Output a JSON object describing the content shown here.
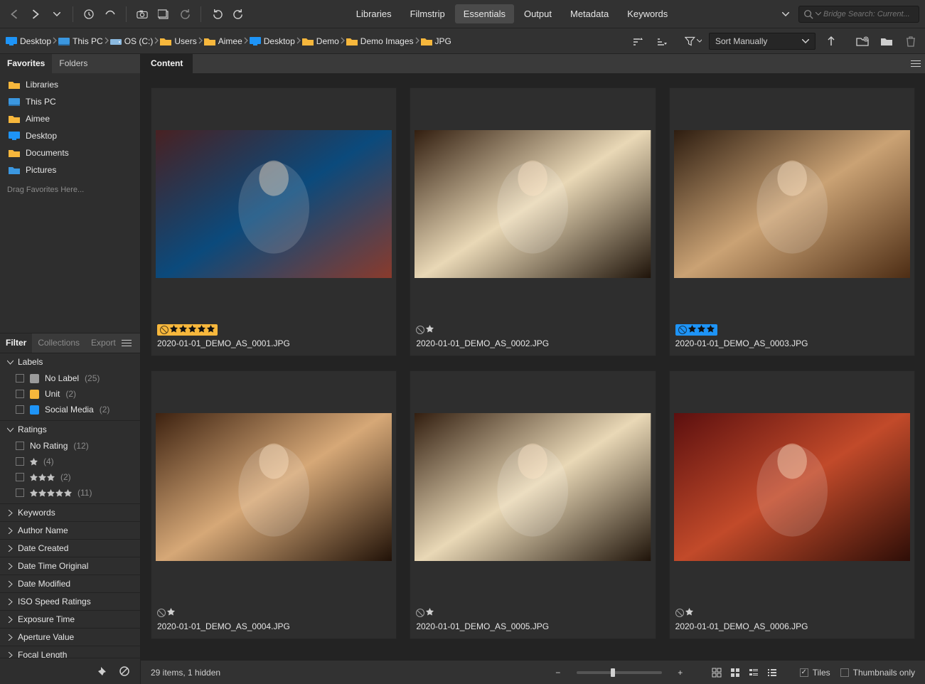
{
  "toolbar": {
    "workspace_tabs": [
      "Libraries",
      "Filmstrip",
      "Essentials",
      "Output",
      "Metadata",
      "Keywords"
    ],
    "workspace_active": 2,
    "search_placeholder": "Bridge Search: Current..."
  },
  "breadcrumb": [
    {
      "label": "Desktop",
      "icon": "desktop"
    },
    {
      "label": "This PC",
      "icon": "pc"
    },
    {
      "label": "OS (C:)",
      "icon": "drive"
    },
    {
      "label": "Users",
      "icon": "folder"
    },
    {
      "label": "Aimee",
      "icon": "folder"
    },
    {
      "label": "Desktop",
      "icon": "desktop"
    },
    {
      "label": "Demo",
      "icon": "folder"
    },
    {
      "label": "Demo Images",
      "icon": "folder"
    },
    {
      "label": "JPG",
      "icon": "folder"
    }
  ],
  "sort": {
    "label": "Sort Manually"
  },
  "side_tabs": {
    "items": [
      "Favorites",
      "Folders"
    ],
    "active": 0
  },
  "favorites": [
    {
      "label": "Libraries",
      "icon": "folder",
      "color": "#f7b73c"
    },
    {
      "label": "This PC",
      "icon": "pc",
      "color": "#3b97e0"
    },
    {
      "label": "Aimee",
      "icon": "folder",
      "color": "#f7b73c"
    },
    {
      "label": "Desktop",
      "icon": "desktop",
      "color": "#3b97e0"
    },
    {
      "label": "Documents",
      "icon": "folder",
      "color": "#f7b73c"
    },
    {
      "label": "Pictures",
      "icon": "folder",
      "color": "#3b97e0"
    }
  ],
  "favorites_hint": "Drag Favorites Here...",
  "filter_tabs": {
    "items": [
      "Filter",
      "Collections",
      "Export"
    ],
    "active": 0
  },
  "filter": {
    "labels": {
      "title": "Labels",
      "items": [
        {
          "name": "No Label",
          "count": "(25)",
          "swatch": "#9b9b9b"
        },
        {
          "name": "Unit",
          "count": "(2)",
          "swatch": "#f7b73c"
        },
        {
          "name": "Social Media",
          "count": "(2)",
          "swatch": "#1e94f7"
        }
      ]
    },
    "ratings": {
      "title": "Ratings",
      "items": [
        {
          "name": "No Rating",
          "count": "(12)",
          "stars": 0
        },
        {
          "name": "",
          "count": "(4)",
          "stars": 1
        },
        {
          "name": "",
          "count": "(2)",
          "stars": 3
        },
        {
          "name": "",
          "count": "(11)",
          "stars": 5
        }
      ]
    },
    "extra": [
      "Keywords",
      "Author Name",
      "Date Created",
      "Date Time Original",
      "Date Modified",
      "ISO Speed Ratings",
      "Exposure Time",
      "Aperture Value",
      "Focal Length"
    ]
  },
  "content_tab": "Content",
  "items": [
    {
      "file": "2020-01-01_DEMO_AS_0001.JPG",
      "rating": 5,
      "label": "yellow"
    },
    {
      "file": "2020-01-01_DEMO_AS_0002.JPG",
      "rating": 1,
      "label": null
    },
    {
      "file": "2020-01-01_DEMO_AS_0003.JPG",
      "rating": 3,
      "label": "blue"
    },
    {
      "file": "2020-01-01_DEMO_AS_0004.JPG",
      "rating": 1,
      "label": null
    },
    {
      "file": "2020-01-01_DEMO_AS_0005.JPG",
      "rating": 1,
      "label": null
    },
    {
      "file": "2020-01-01_DEMO_AS_0006.JPG",
      "rating": 1,
      "label": null
    }
  ],
  "status": {
    "text": "29 items,  1 hidden",
    "tiles": "Tiles",
    "thumbs_only": "Thumbnails only"
  }
}
